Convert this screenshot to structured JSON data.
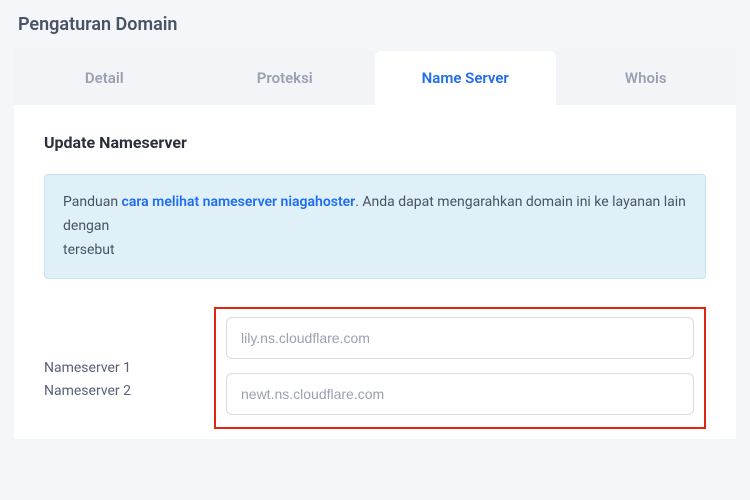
{
  "page": {
    "title": "Pengaturan Domain"
  },
  "tabs": {
    "detail": "Detail",
    "proteksi": "Proteksi",
    "nameserver": "Name Server",
    "whois": "Whois"
  },
  "section": {
    "title": "Update Nameserver"
  },
  "info": {
    "prefix": "Panduan ",
    "link": "cara melihat nameserver niagahoster",
    "suffix": ". Anda dapat mengarahkan domain ini ke layanan lain dengan",
    "line2": "tersebut"
  },
  "form": {
    "ns1_label": "Nameserver 1",
    "ns1_value": "lily.ns.cloudflare.com",
    "ns2_label": "Nameserver 2",
    "ns2_value": "newt.ns.cloudflare.com"
  }
}
